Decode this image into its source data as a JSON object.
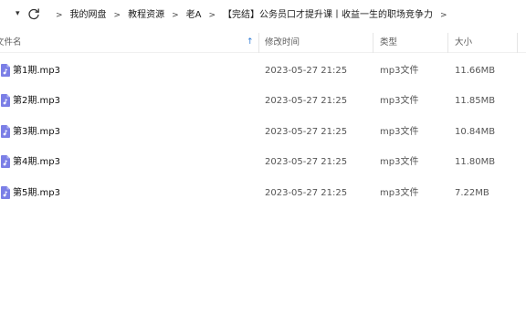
{
  "nav": {
    "down_arrow": "▾",
    "separator": ">"
  },
  "breadcrumb": [
    "我的网盘",
    "教程资源",
    "老A",
    "【完结】公务员口才提升课丨收益一生的职场竞争力"
  ],
  "columns": {
    "name": "文件名",
    "modified": "修改时间",
    "type": "类型",
    "size": "大小"
  },
  "sort_indicator": "↑",
  "files": [
    {
      "name": "第1期.mp3",
      "modified": "2023-05-27 21:25",
      "type": "mp3文件",
      "size": "11.66MB"
    },
    {
      "name": "第2期.mp3",
      "modified": "2023-05-27 21:25",
      "type": "mp3文件",
      "size": "11.85MB"
    },
    {
      "name": "第3期.mp3",
      "modified": "2023-05-27 21:25",
      "type": "mp3文件",
      "size": "10.84MB"
    },
    {
      "name": "第4期.mp3",
      "modified": "2023-05-27 21:25",
      "type": "mp3文件",
      "size": "11.80MB"
    },
    {
      "name": "第5期.mp3",
      "modified": "2023-05-27 21:25",
      "type": "mp3文件",
      "size": "7.22MB"
    }
  ],
  "icons": {
    "file": "audio-file-icon",
    "refresh": "refresh-icon"
  },
  "colors": {
    "file_icon": "#7b7fe6",
    "sort_arrow": "#2b78d4"
  }
}
